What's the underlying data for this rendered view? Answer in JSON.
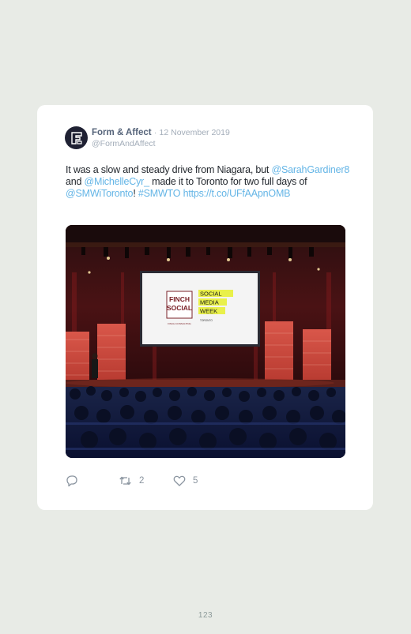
{
  "tweet": {
    "author": "Form & Affect",
    "separator": "·",
    "date": "12 November 2019",
    "handle": "@FormAndAffect",
    "text": {
      "part1": "It was a slow and steady drive from Niagara, but ",
      "mention1": "@SarahGardiner8",
      "part2": " and ",
      "mention2": "@MichelleCyr_",
      "part3": " made it to Toronto for two full days of ",
      "mention3": "@SMWiToronto",
      "part4": "! ",
      "hashtag": "#SMWTO",
      "space": " ",
      "url": "https://t.co/UFfAApnOMB"
    },
    "photo": {
      "slide_left_line1": "FINCH",
      "slide_left_line2": "SOCIAL",
      "slide_left_sub": "FINCH CONSULTING",
      "slide_right_line1": "SOCIAL",
      "slide_right_line2": "MEDIA",
      "slide_right_line3": "WEEK",
      "slide_right_sub": "TORONTO"
    },
    "actions": {
      "reply_icon": "reply-icon",
      "retweet_icon": "retweet-icon",
      "retweet_count": "2",
      "like_icon": "heart-icon",
      "like_count": "5"
    }
  },
  "page_number": "123",
  "colors": {
    "background": "#e8ebe6",
    "card": "#ffffff",
    "link": "#64b5e6",
    "author": "#56647a",
    "muted": "#a3adb9"
  }
}
